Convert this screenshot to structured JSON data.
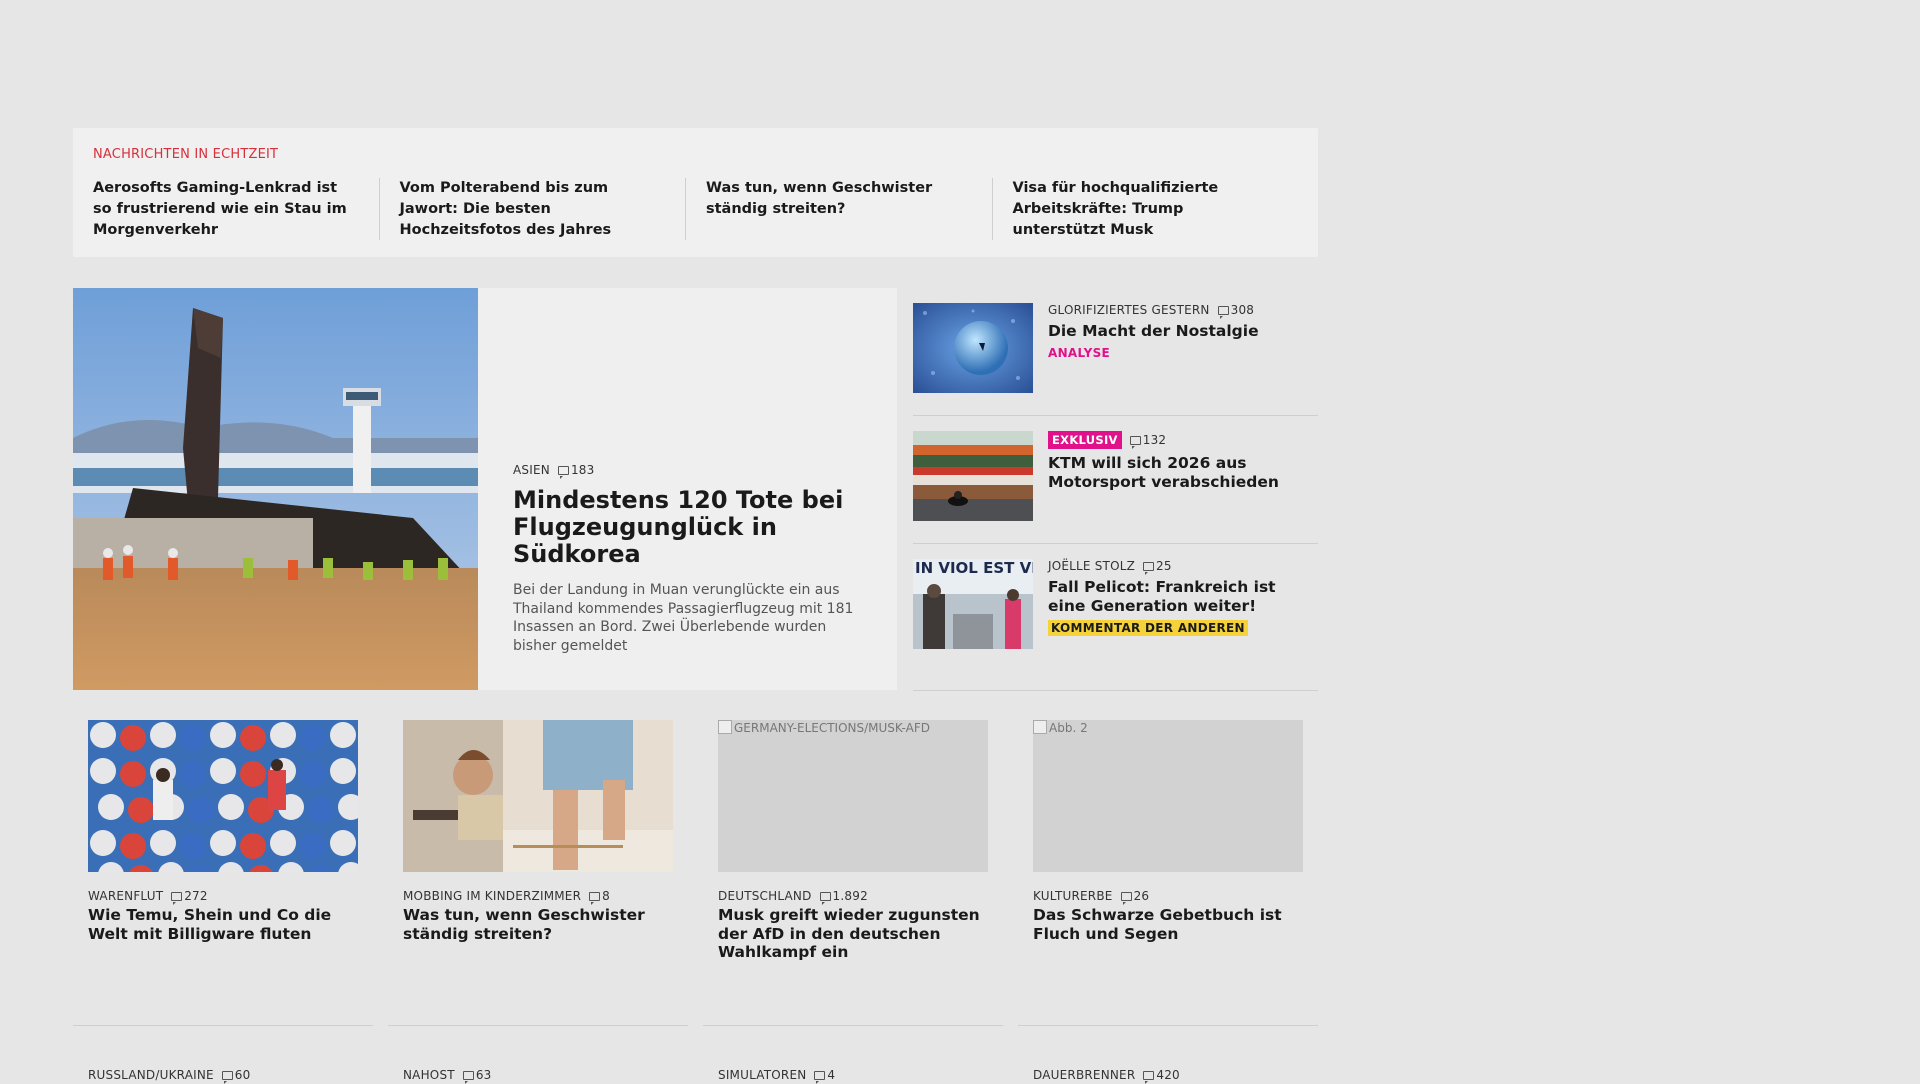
{
  "ticker": {
    "title": "NACHRICHTEN IN ECHTZEIT",
    "items": [
      "Aerosofts Gaming-Lenkrad ist so frus­trierend wie ein Stau im Morgenverkehr",
      "Vom Polterabend bis zum Jawort: Die besten Hochzeitsfotos des Jahres",
      "Was tun, wenn Geschwister ständig streiten?",
      "Visa für hochqualifizierte Arbeits­kräfte: Trump unterstützt Musk"
    ]
  },
  "hero": {
    "kicker": "ASIEN",
    "comments": "183",
    "title": "Mindestens 120 Tote bei Flug­zeugunglück in Südkorea",
    "teaser": "Bei der Landung in Muan verunglückte ein aus Thailand kommendes Passagierflugzeug mit 181 Insassen an Bord. Zwei Überlebende wurden bisher gemeldet"
  },
  "side": [
    {
      "kicker": "GLORIFIZIERTES GESTERN",
      "comments": "308",
      "title": "Die Macht der Nostalgie",
      "tag": "ANALYSE"
    },
    {
      "badge": "EXKLUSIV",
      "comments": "132",
      "title": "KTM will sich 2026 aus Motorsport verabschieden"
    },
    {
      "kicker": "JOËLLE STOLZ",
      "comments": "25",
      "title": "Fall Pelicot: Frankreich ist eine Generation weiter!",
      "tag": "KOMMENTAR DER ANDEREN",
      "image_text": "IN VIOL EST VIOL"
    }
  ],
  "cards": [
    {
      "kicker": "WARENFLUT",
      "comments": "272",
      "title": "Wie Temu, Shein und Co die Welt mit Billigware fluten"
    },
    {
      "kicker": "MOBBING IM KINDERZIMMER",
      "comments": "8",
      "title": "Was tun, wenn Geschwister ständig streiten?"
    },
    {
      "kicker": "DEUTSCHLAND",
      "comments": "1.892",
      "title": "Musk greift wieder zugunsten der AfD in den deutschen Wahlkampf ein",
      "broken_alt": "GERMANY-ELECTIONS/MUSK-AFD"
    },
    {
      "kicker": "KULTURERBE",
      "comments": "26",
      "title": "Das Schwarze Gebetbuch ist Fluch und Segen",
      "broken_alt": "Abb. 2"
    }
  ],
  "next_row": [
    {
      "kicker": "RUSSLAND/UKRAINE",
      "comments": "60"
    },
    {
      "kicker": "NAHOST",
      "comments": "63"
    },
    {
      "kicker": "SIMULATOREN",
      "comments": "4"
    },
    {
      "kicker": "DAUERBRENNER",
      "comments": "420"
    }
  ],
  "colors": {
    "accent_red": "#d6303a",
    "accent_pink": "#e0118a",
    "accent_yellow": "#f5d23a",
    "page_bg": "#e6e6e6"
  }
}
